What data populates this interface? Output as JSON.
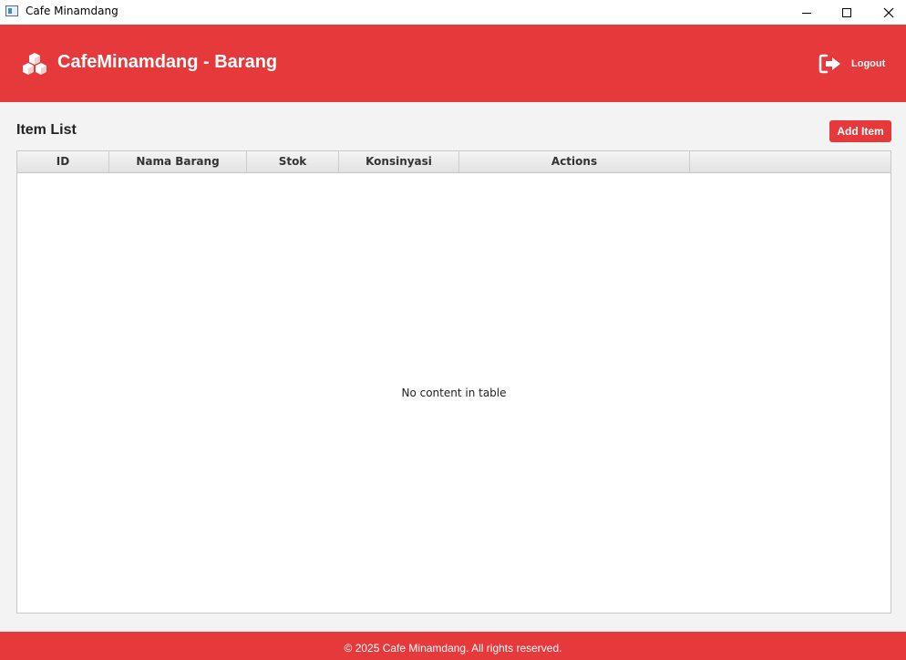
{
  "window": {
    "title": "Cafe Minamdang",
    "controls": {
      "minimize_icon": "minimize-icon",
      "maximize_icon": "maximize-icon",
      "close_icon": "close-icon"
    }
  },
  "header": {
    "logo_icon": "cubes-icon",
    "brand": "CafeMinamdang - Barang",
    "logout_icon": "sign-out-icon",
    "logout_label": "Logout",
    "background": "#e5393b"
  },
  "main": {
    "section_title": "Item List",
    "add_button_label": "Add Item",
    "table": {
      "columns": [
        "ID",
        "Nama Barang",
        "Stok",
        "Konsinyasi",
        "Actions",
        ""
      ],
      "rows": [],
      "empty_message": "No content in table"
    }
  },
  "footer": {
    "text": "© 2025 Cafe Minamdang. All rights reserved."
  }
}
